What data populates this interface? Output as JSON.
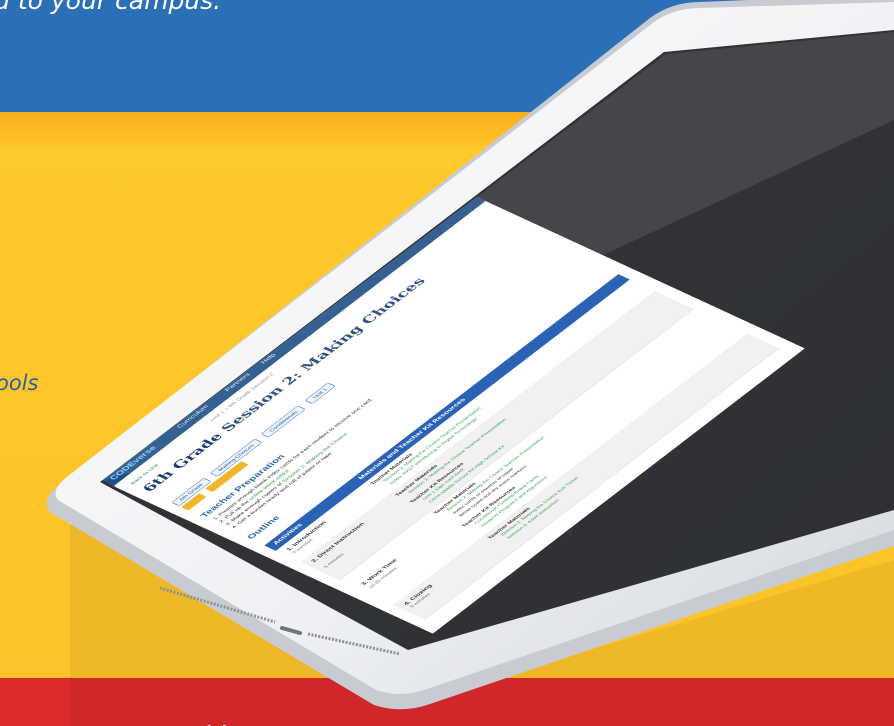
{
  "banner": {
    "headline_fragment": "d to your campus.",
    "side_fragment": "ools",
    "bottom_fragment": ". ."
  },
  "colors": {
    "top_band": "#2b6fb6",
    "middle_band": "#fdc32a",
    "bottom_band": "#dd2a2d",
    "tablet_body": "#f4f5f7",
    "screen_nav": "#1d4f86",
    "accent_green": "#2f9a4a",
    "table_header": "#2a63b5"
  },
  "screen": {
    "logo": "CODEverse",
    "nav_items": [
      "Curriculum",
      "Partners",
      "Help"
    ],
    "breadcrumb": "Unit 1 > 6th Grade Session 2",
    "back_link": "Back to Unit",
    "title": "6th Grade Session 2: Making Choices",
    "tags": [
      "6th Grade",
      "Making Choices",
      "Conditionals",
      "Unit 1"
    ],
    "teacher_prep": {
      "heading": "Teacher Preparation",
      "lines": [
        {
          "text": "1. Prepare enough blank index cards for each student to receive one card.",
          "link": ""
        },
        {
          "text": "2. Pull up the ",
          "link": "online block editor"
        },
        {
          "text": "3. Make enough copies of ",
          "link": "Session 2: Making the Choice"
        },
        {
          "text": "4. Get a bucket ready and roll of paper or tape",
          "link": ""
        }
      ]
    },
    "outline": {
      "heading": "Outline",
      "col_activities": "Activities",
      "col_materials": "Materials and Teacher Kit Resources",
      "rows": [
        {
          "name": "1. Introduction",
          "time": "5 minutes",
          "groups": [
            {
              "title": "Teacher Materials",
              "links": [
                "Session 2: Making the Choice Teacher Presentation",
                "Video: DIGIT Introducing to Digital Technology"
              ]
            }
          ]
        },
        {
          "name": "2. Direct Instruction",
          "time": "5 minutes",
          "groups": [
            {
              "title": "Teacher Materials",
              "links": [
                "Session 2: Making the Choice Teacher Presentation"
              ]
            },
            {
              "title": "Teacher Kit Resources",
              "links": [
                "Unit 1 logic card deck",
                "CSTA Middle School Kit High School Kit"
              ]
            }
          ]
        },
        {
          "name": "3. Work Time",
          "time": "15-20 minutes",
          "groups": [
            {
              "title": "Teacher Materials",
              "links": [
                "Session 2: Making the Choice Teacher Presentation",
                "Index cards or squares of paper",
                "White board and dry erase markers"
              ]
            },
            {
              "title": "Teacher Kit Resources",
              "links": [
                "Conditional Thinking Board Cards",
                "Students Programs and Algorithms"
              ]
            }
          ]
        },
        {
          "name": "4. Closing",
          "time": "5 minutes",
          "groups": [
            {
              "title": "Teacher Materials",
              "links": [
                "Session 2: Making the Choice Exit Ticket",
                "Session 2: Adult Instruction"
              ]
            }
          ]
        }
      ]
    }
  }
}
